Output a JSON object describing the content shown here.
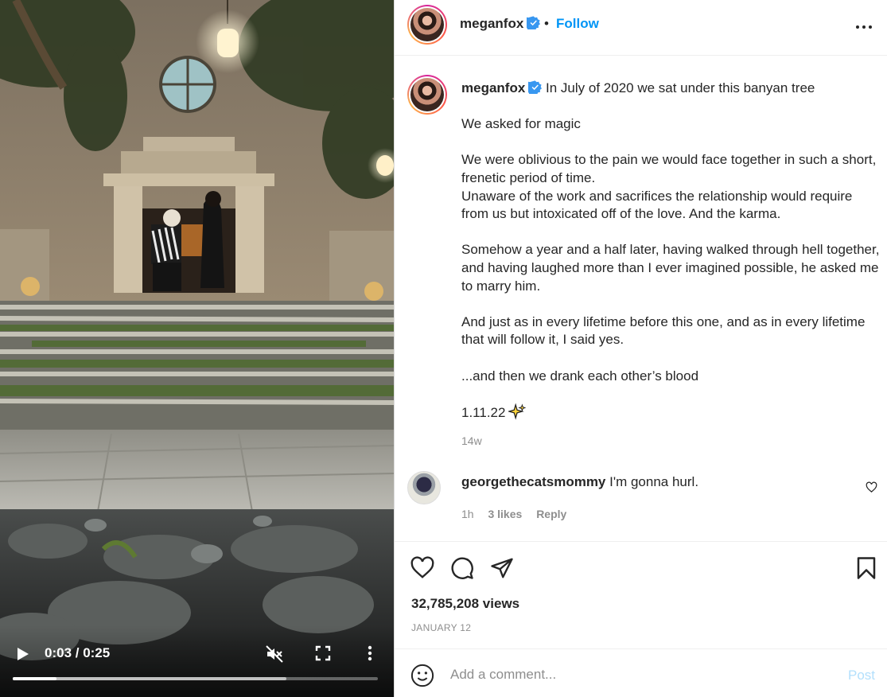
{
  "video": {
    "current_time": "0:03",
    "duration": "0:25",
    "time_display": "0:03 / 0:25",
    "progress_fraction": 0.12,
    "buffered_fraction": 0.75,
    "muted": true
  },
  "header": {
    "username": "meganfox",
    "separator": "•",
    "follow_label": "Follow",
    "options_icon": "more-horizontal-icon"
  },
  "caption": {
    "username": "meganfox",
    "first_line": "In July of 2020 we sat under this banyan tree",
    "paragraphs": [
      [
        "We asked for magic"
      ],
      [
        "We were oblivious to the pain we would face together in such a short, frenetic period of time.",
        "Unaware of the work and sacrifices the relationship would require from us but intoxicated off of the love. And the karma."
      ],
      [
        "Somehow a year and a half later, having walked through hell together, and having laughed more than I ever imagined possible, he asked me to marry him."
      ],
      [
        "And just as in every lifetime before this one, and as in every lifetime that will follow it, I said yes."
      ],
      [
        "...and then we drank each other’s blood"
      ]
    ],
    "date_line": "1.11.22",
    "time_ago": "14w"
  },
  "comment": {
    "username": "georgethecatsmommy",
    "text": "I'm gonna hurl.",
    "time": "1h",
    "likes": "3 likes",
    "reply_label": "Reply"
  },
  "actions": {
    "views": "32,785,208 views",
    "date": "JANUARY 12"
  },
  "add_comment": {
    "placeholder": "Add a comment...",
    "post_label": "Post"
  },
  "colors": {
    "accent": "#0095f6",
    "post_disabled": "#b2dffc",
    "muted_text": "#8e8e8e",
    "verified": "#3897f0"
  }
}
